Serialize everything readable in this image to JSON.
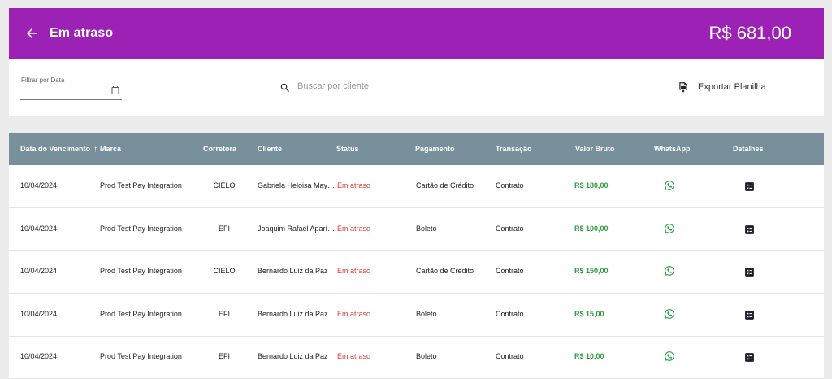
{
  "header": {
    "title": "Em atraso",
    "total": "R$ 681,00",
    "bg_color": "#9c22b5"
  },
  "filters": {
    "date_label": "Filtrar por Data",
    "search_placeholder": "Buscar por cliente",
    "export_label": "Exportar Planilha"
  },
  "table": {
    "header_bg": "#78909c",
    "columns": [
      "Data do Vencimento",
      "Marca",
      "Corretora",
      "Cliente",
      "Status",
      "Pagamento",
      "Transação",
      "Valor Bruto",
      "WhatsApp",
      "Detalhes"
    ],
    "sort_indicator": "↑",
    "rows": [
      {
        "date": "10/04/2024",
        "brand": "Prod Test Pay Integration",
        "broker": "CIELO",
        "client": "Gabriela Heloisa Maya ...",
        "status": "Em atraso",
        "payment": "Cartão de Crédito",
        "transaction": "Contrato",
        "value": "R$ 180,00"
      },
      {
        "date": "10/04/2024",
        "brand": "Prod Test Pay Integration",
        "broker": "EFI",
        "client": "Joaquim Rafael Aparício",
        "status": "Em atraso",
        "payment": "Boleto",
        "transaction": "Contrato",
        "value": "R$ 100,00"
      },
      {
        "date": "10/04/2024",
        "brand": "Prod Test Pay Integration",
        "broker": "CIELO",
        "client": "Bernardo Luiz da Paz",
        "status": "Em atraso",
        "payment": "Cartão de Crédito",
        "transaction": "Contrato",
        "value": "R$ 150,00"
      },
      {
        "date": "10/04/2024",
        "brand": "Prod Test Pay Integration",
        "broker": "EFI",
        "client": "Bernardo Luiz da Paz",
        "status": "Em atraso",
        "payment": "Boleto",
        "transaction": "Contrato",
        "value": "R$ 15,00"
      },
      {
        "date": "10/04/2024",
        "brand": "Prod Test Pay Integration",
        "broker": "EFI",
        "client": "Bernardo Luiz da Paz",
        "status": "Em atraso",
        "payment": "Boleto",
        "transaction": "Contrato",
        "value": "R$ 10,00"
      }
    ],
    "row_icons": {
      "whatsapp": "whatsapp-icon",
      "details": "details-icon"
    },
    "status_color": "#e53935",
    "value_color": "#2e9b3e"
  }
}
